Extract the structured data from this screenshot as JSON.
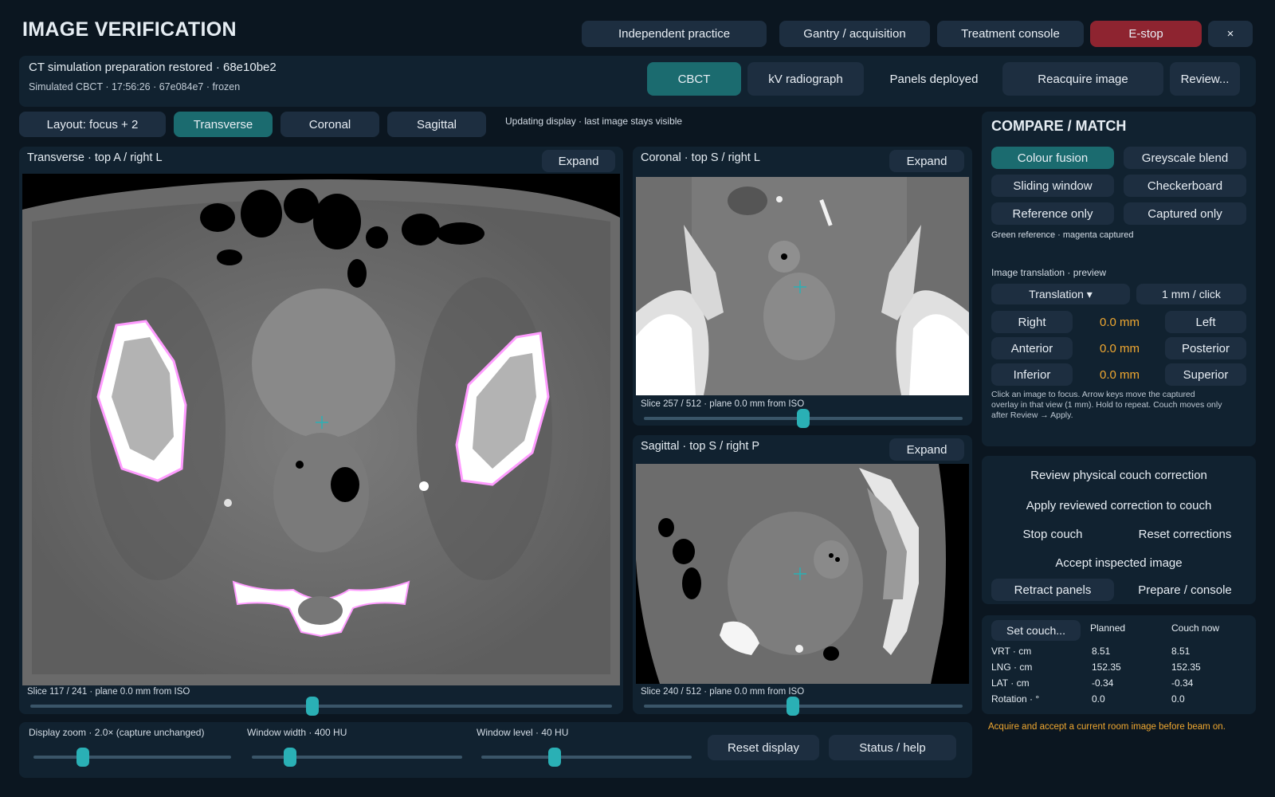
{
  "app": {
    "title": "IMAGE VERIFICATION"
  },
  "top_nav": {
    "independent": "Independent practice",
    "gantry": "Gantry / acquisition",
    "console": "Treatment console",
    "estop": "E-stop",
    "close": "×"
  },
  "session": {
    "title": "CT simulation preparation restored · 68e10be2",
    "subtitle": "Simulated CBCT · 17:56:26 · 67e084e7 · frozen"
  },
  "modality": {
    "cbct": "CBCT",
    "kv": "kV radiograph",
    "panels": "Panels deployed",
    "reacquire": "Reacquire image",
    "review": "Review..."
  },
  "view_tabs": {
    "layout": "Layout: focus + 2",
    "transverse": "Transverse",
    "coronal": "Coronal",
    "sagittal": "Sagittal",
    "status": "Updating display · last image stays visible"
  },
  "views": {
    "transverse": {
      "title": "Transverse · top A / right L",
      "expand": "Expand",
      "slice": "Slice 117 / 241 · plane 0.0 mm from ISO",
      "slider": 0.485
    },
    "coronal": {
      "title": "Coronal · top S / right L",
      "expand": "Expand",
      "slice": "Slice 257 / 512 · plane 0.0 mm from ISO",
      "slider": 0.5
    },
    "sagittal": {
      "title": "Sagittal · top S / right P",
      "expand": "Expand",
      "slice": "Slice 240 / 512 · plane 0.0 mm from ISO",
      "slider": 0.467
    }
  },
  "bottom_controls": {
    "zoom": {
      "label": "Display zoom · 2.0× (capture unchanged)",
      "value": 0.25
    },
    "width": {
      "label": "Window width · 400 HU",
      "value": 0.18
    },
    "level": {
      "label": "Window level · 40 HU",
      "value": 0.35
    },
    "reset": "Reset display",
    "status": "Status / help"
  },
  "compare": {
    "title": "COMPARE / MATCH",
    "colour_fusion": "Colour fusion",
    "greyscale_blend": "Greyscale blend",
    "sliding_window": "Sliding window",
    "checkerboard": "Checkerboard",
    "reference_only": "Reference only",
    "captured_only": "Captured only",
    "legend": "Green reference · magenta captured",
    "translation_header": "Image translation · preview",
    "translation_select": "Translation ▾",
    "step": "1 mm / click",
    "rows": [
      {
        "neg": "Right",
        "value": "0.0 mm",
        "pos": "Left"
      },
      {
        "neg": "Anterior",
        "value": "0.0 mm",
        "pos": "Posterior"
      },
      {
        "neg": "Inferior",
        "value": "0.0 mm",
        "pos": "Superior"
      }
    ],
    "help": [
      "Click an image to focus. Arrow keys move the captured",
      "overlay in that view (1 mm). Hold to repeat. Couch moves only",
      "after Review → Apply."
    ]
  },
  "couch_actions": {
    "review": "Review physical couch correction",
    "apply": "Apply reviewed correction to couch",
    "stop": "Stop couch",
    "reset": "Reset corrections",
    "accept": "Accept inspected image",
    "retract": "Retract panels",
    "prepare": "Prepare / console"
  },
  "couch_table": {
    "set_button": "Set couch...",
    "col_planned": "Planned",
    "col_now": "Couch now",
    "rows": [
      {
        "label": "VRT · cm",
        "planned": "8.51",
        "now": "8.51"
      },
      {
        "label": "LNG · cm",
        "planned": "152.35",
        "now": "152.35"
      },
      {
        "label": "LAT · cm",
        "planned": "-0.34",
        "now": "-0.34"
      },
      {
        "label": "Rotation · °",
        "planned": "0.0",
        "now": "0.0"
      }
    ]
  },
  "warning": "Acquire and accept a current room image before beam on.",
  "colors": {
    "accent": "#2ab0b5",
    "active": "#1b6b6f",
    "estop": "#8e2430",
    "warning": "#f0a830"
  }
}
